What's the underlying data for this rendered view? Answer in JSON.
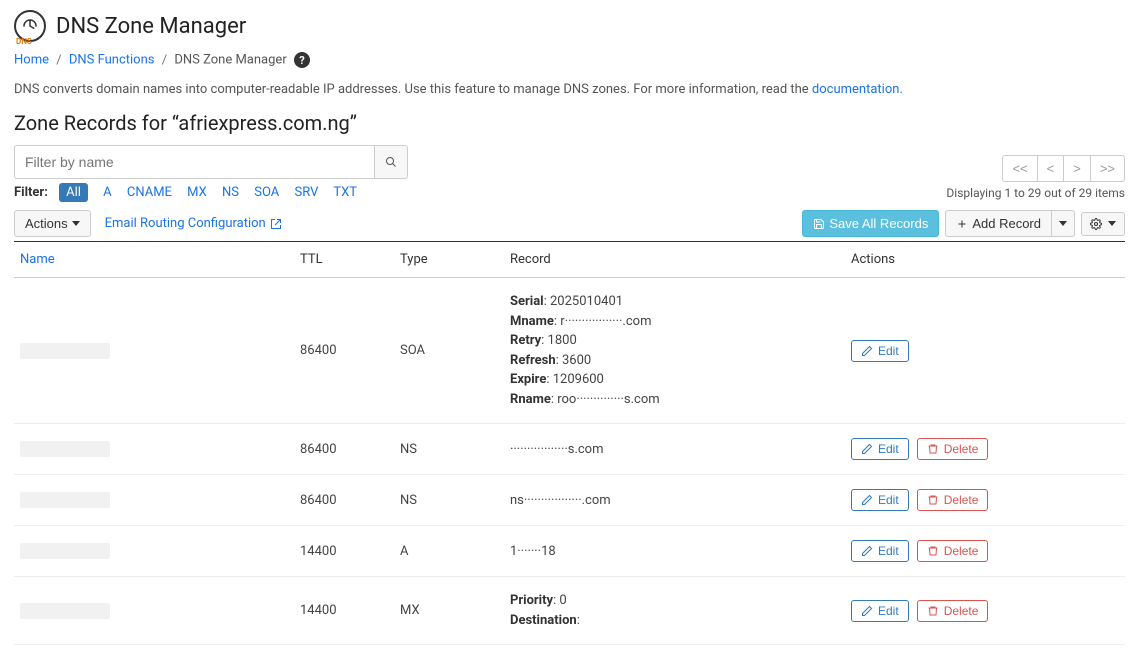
{
  "header": {
    "title": "DNS Zone Manager",
    "icon_tag": "DNS"
  },
  "breadcrumb": {
    "home": "Home",
    "dns_functions": "DNS Functions",
    "current": "DNS Zone Manager"
  },
  "intro": {
    "text_before_link": "DNS converts domain names into computer-readable IP addresses. Use this feature to manage DNS zones. For more information, read the ",
    "link_text": "documentation",
    "text_after_link": "."
  },
  "section_title": "Zone Records for “afriexpress.com.ng”",
  "filter": {
    "placeholder": "Filter by name",
    "label": "Filter:",
    "types": {
      "all": "All",
      "a": "A",
      "cname": "CNAME",
      "mx": "MX",
      "ns": "NS",
      "soa": "SOA",
      "srv": "SRV",
      "txt": "TXT"
    }
  },
  "pager": {
    "first": "<<",
    "prev": "<",
    "next": ">",
    "last": ">>",
    "status": "Displaying 1 to 29 out of 29 items"
  },
  "toolbar": {
    "actions": "Actions",
    "email_routing": "Email Routing Configuration",
    "save_all": "Save All Records",
    "add_record": "Add Record"
  },
  "table": {
    "headers": {
      "name": "Name",
      "ttl": "TTL",
      "type": "Type",
      "record": "Record",
      "actions": "Actions"
    },
    "action_labels": {
      "edit": "Edit",
      "delete": "Delete"
    },
    "rows": [
      {
        "name": "",
        "ttl": "86400",
        "type": "SOA",
        "record": {
          "Serial": "2025010401",
          "Mname": "r​·················.com",
          "Retry": "1800",
          "Refresh": "3600",
          "Expire": "1209600",
          "Rname": "roo​··············s.com"
        },
        "can_delete": false
      },
      {
        "name": "",
        "ttl": "86400",
        "type": "NS",
        "record_text": "·················s.com",
        "can_delete": true
      },
      {
        "name": "",
        "ttl": "86400",
        "type": "NS",
        "record_text": "ns​·················.com",
        "can_delete": true
      },
      {
        "name": "",
        "ttl": "14400",
        "type": "A",
        "record_text": "1​·······18",
        "can_delete": true
      },
      {
        "name": "",
        "ttl": "14400",
        "type": "MX",
        "record": {
          "Priority": "0",
          "Destination": ""
        },
        "can_delete": true
      }
    ]
  }
}
